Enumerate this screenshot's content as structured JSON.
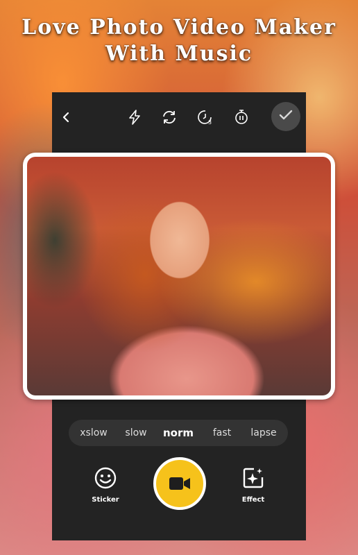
{
  "header": {
    "title_line1": "Love Photo Video Maker",
    "title_line2": "With Music"
  },
  "topbar": {
    "icons": [
      "back-icon",
      "flash-icon",
      "switch-camera-icon",
      "timer-3-icon",
      "stopwatch-icon",
      "check-icon"
    ]
  },
  "speed": {
    "options": [
      "xslow",
      "slow",
      "norm",
      "fast",
      "lapse"
    ],
    "selected": "norm"
  },
  "tools": {
    "sticker_label": "Sticker",
    "effect_label": "Effect"
  },
  "colors": {
    "panel": "#232323",
    "record_button": "#f6c21b",
    "check_button": "#4a4a4a"
  }
}
